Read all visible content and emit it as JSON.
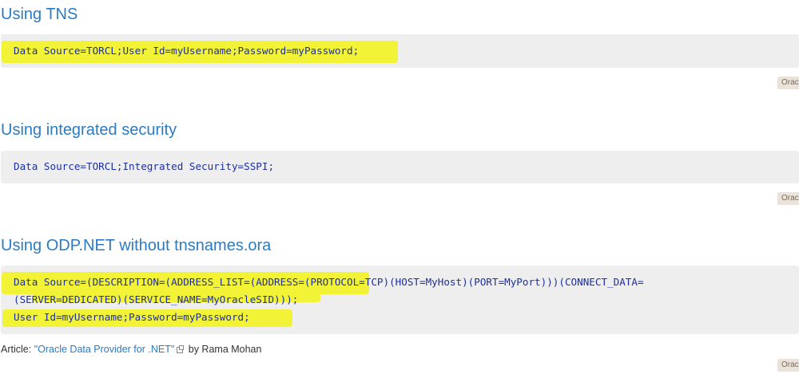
{
  "sections": [
    {
      "heading": "Using TNS",
      "code_lines": [
        "Data Source=TORCL;User Id=myUsername;Password=myPassword;"
      ],
      "badge": "Oracle"
    },
    {
      "heading": "Using integrated security",
      "code_lines": [
        "Data Source=TORCL;Integrated Security=SSPI;"
      ],
      "badge": "Oracle"
    },
    {
      "heading": "Using ODP.NET without tnsnames.ora",
      "code_lines": [
        "Data Source=(DESCRIPTION=(ADDRESS_LIST=(ADDRESS=(PROTOCOL=TCP)(HOST=MyHost)(PORT=MyPort)))(CONNECT_DATA=",
        "(SERVER=DEDICATED)(SERVICE_NAME=MyOracleSID)));",
        "User Id=myUsername;Password=myPassword;"
      ],
      "badge": "Oracle"
    }
  ],
  "article": {
    "prefix": "Article: ",
    "link_text": "\"Oracle Data Provider for .NET\"",
    "suffix": " by Rama Mohan"
  },
  "colors": {
    "heading": "#2b7bc4",
    "code_text": "#1c2fa3",
    "code_bg": "#eeeeee",
    "highlight": "#f2f236",
    "badge_bg": "#ebe3da"
  }
}
